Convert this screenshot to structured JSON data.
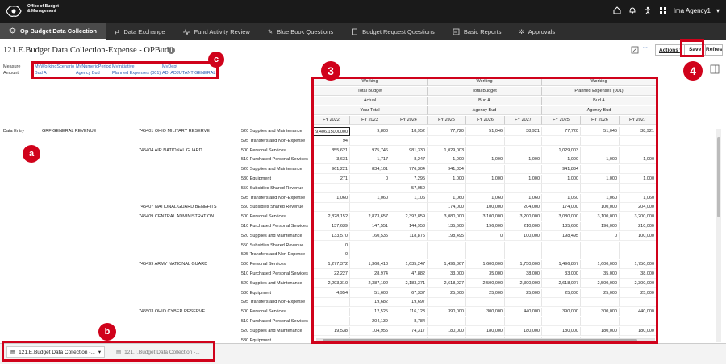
{
  "header": {
    "org_line1": "Office of Budget",
    "org_line2": "& Management",
    "user": "Ima Agency1"
  },
  "nav": {
    "tabs": [
      "Op Budget Data Collection",
      "Data Exchange",
      "Fund Activity Review",
      "Blue Book Questions",
      "Budget Request Questions",
      "Basic Reports",
      "Approvals"
    ]
  },
  "page": {
    "title": "121.E.Budget Data Collection-Expense - OPBud",
    "actions_label": "Actions",
    "save_label": "Save",
    "refresh_label": "Refresh",
    "more_label": "···"
  },
  "pov": {
    "measure_label": "Measure",
    "amount_label": "Amount",
    "items": [
      {
        "name": "MyWorkingScenario",
        "value": "Bud A"
      },
      {
        "name": "MyNumericPeriod",
        "value": "Agency Bud"
      },
      {
        "name": "MyInitiative",
        "value": "Planned Expenses (001)"
      },
      {
        "name": "MyDept",
        "value": "ADI ADJUTANT GENERAL"
      }
    ]
  },
  "grid": {
    "groups": [
      {
        "row1": "Working",
        "row2": "Total Budget",
        "row3": "Actual",
        "row4": "Year Total"
      },
      {
        "row1": "Working",
        "row2": "Total Budget",
        "row3": "Bud A",
        "row4": "Agency Bud"
      },
      {
        "row1": "Working",
        "row2": "Planned Expenses (001)",
        "row3": "Bud A",
        "row4": "Agency Bud"
      }
    ],
    "years": [
      "FY 2022",
      "FY 2023",
      "FY 2024",
      "FY 2025",
      "FY 2026",
      "FY 2027",
      "FY 2025",
      "FY 2026",
      "FY 2027"
    ],
    "data_entry_label": "Data Entry",
    "fund_label": "GRF GENERAL REVENUE",
    "rows": [
      {
        "dept": "745401 OHIO MILITARY RESERVE",
        "acct": "520 Supplies and Maintenance",
        "v": [
          "9,406.15000000",
          "9,800",
          "18,952",
          "77,720",
          "51,046",
          "38,921",
          "77,720",
          "51,046",
          "38,921"
        ]
      },
      {
        "dept": "",
        "acct": "595 Transfers and Non-Expense",
        "v": [
          "94",
          "",
          "",
          "",
          "",
          "",
          "",
          "",
          ""
        ]
      },
      {
        "dept": "745404 AIR NATIONAL GUARD",
        "acct": "500 Personal Services",
        "v": [
          "855,621",
          "975,746",
          "981,330",
          "1,029,003",
          "",
          "",
          "1,029,003",
          "",
          ""
        ]
      },
      {
        "dept": "",
        "acct": "510 Purchased Personal Services",
        "v": [
          "3,631",
          "1,717",
          "8,247",
          "1,000",
          "1,000",
          "1,000",
          "1,000",
          "1,000",
          "1,000"
        ]
      },
      {
        "dept": "",
        "acct": "520 Supplies and Maintenance",
        "v": [
          "961,221",
          "834,101",
          "776,304",
          "941,834",
          "",
          "",
          "941,834",
          "",
          ""
        ]
      },
      {
        "dept": "",
        "acct": "530 Equipment",
        "v": [
          "271",
          "0",
          "7,295",
          "1,000",
          "1,000",
          "1,000",
          "1,000",
          "1,000",
          "1,000"
        ]
      },
      {
        "dept": "",
        "acct": "550 Subsidies Shared Revenue",
        "v": [
          "",
          "",
          "57,050",
          "",
          "",
          "",
          "",
          "",
          ""
        ]
      },
      {
        "dept": "",
        "acct": "595 Transfers and Non-Expense",
        "v": [
          "1,060",
          "1,060",
          "1,106",
          "1,060",
          "1,060",
          "1,060",
          "1,060",
          "1,060",
          "1,060"
        ]
      },
      {
        "dept": "745407 NATIONAL GUARD BENEFITS",
        "acct": "550 Subsidies Shared Revenue",
        "v": [
          "",
          "",
          "",
          "174,000",
          "100,000",
          "204,000",
          "174,000",
          "100,000",
          "204,000"
        ]
      },
      {
        "dept": "745409 CENTRAL ADMINISTRATION",
        "acct": "500 Personal Services",
        "v": [
          "2,828,152",
          "2,873,657",
          "2,392,859",
          "3,080,000",
          "3,100,000",
          "3,200,000",
          "3,080,000",
          "3,100,000",
          "3,200,000"
        ]
      },
      {
        "dept": "",
        "acct": "510 Purchased Personal Services",
        "v": [
          "137,639",
          "147,551",
          "144,953",
          "135,600",
          "196,000",
          "210,000",
          "135,600",
          "196,000",
          "210,000"
        ]
      },
      {
        "dept": "",
        "acct": "520 Supplies and Maintenance",
        "v": [
          "133,570",
          "160,535",
          "118,875",
          "198,495",
          "0",
          "100,000",
          "198,495",
          "0",
          "100,000"
        ]
      },
      {
        "dept": "",
        "acct": "550 Subsidies Shared Revenue",
        "v": [
          "0",
          "",
          "",
          "",
          "",
          "",
          "",
          "",
          ""
        ]
      },
      {
        "dept": "",
        "acct": "595 Transfers and Non-Expense",
        "v": [
          "0",
          "",
          "",
          "",
          "",
          "",
          "",
          "",
          ""
        ]
      },
      {
        "dept": "745499 ARMY NATIONAL GUARD",
        "acct": "500 Personal Services",
        "v": [
          "1,277,372",
          "1,368,410",
          "1,635,247",
          "1,496,867",
          "1,600,000",
          "1,750,000",
          "1,496,867",
          "1,600,000",
          "1,750,000"
        ]
      },
      {
        "dept": "",
        "acct": "510 Purchased Personal Services",
        "v": [
          "22,227",
          "28,974",
          "47,882",
          "33,000",
          "35,000",
          "38,000",
          "33,000",
          "35,000",
          "38,000"
        ]
      },
      {
        "dept": "",
        "acct": "520 Supplies and Maintenance",
        "v": [
          "2,293,310",
          "2,387,192",
          "2,183,371",
          "2,618,027",
          "2,500,000",
          "2,300,000",
          "2,618,027",
          "2,500,000",
          "2,300,000"
        ]
      },
      {
        "dept": "",
        "acct": "530 Equipment",
        "v": [
          "4,954",
          "51,608",
          "67,337",
          "25,000",
          "25,000",
          "25,000",
          "25,000",
          "25,000",
          "25,000"
        ]
      },
      {
        "dept": "",
        "acct": "595 Transfers and Non-Expense",
        "v": [
          "",
          "19,682",
          "19,697",
          "",
          "",
          "",
          "",
          "",
          ""
        ]
      },
      {
        "dept": "745503 OHIO CYBER RESERVE",
        "acct": "500 Personal Services",
        "v": [
          "",
          "12,525",
          "116,123",
          "390,000",
          "300,000",
          "440,000",
          "390,000",
          "300,000",
          "440,000"
        ]
      },
      {
        "dept": "",
        "acct": "510 Purchased Personal Services",
        "v": [
          "",
          "204,139",
          "8,784",
          "",
          "",
          "",
          "",
          "",
          ""
        ]
      },
      {
        "dept": "",
        "acct": "520 Supplies and Maintenance",
        "v": [
          "19,538",
          "104,955",
          "74,317",
          "180,000",
          "180,000",
          "180,000",
          "180,000",
          "180,000",
          "180,000"
        ]
      },
      {
        "dept": "",
        "acct": "530 Equipment",
        "v": [
          "",
          "",
          "",
          "",
          "",
          "",
          "",
          "",
          ""
        ]
      }
    ]
  },
  "bottom_tabs": [
    "121.E.Budget Data Collection -...",
    "121.T.Budget Data Collection -..."
  ],
  "callouts": {
    "a": "a",
    "b": "b",
    "c": "c",
    "n3": "3",
    "n4": "4"
  }
}
